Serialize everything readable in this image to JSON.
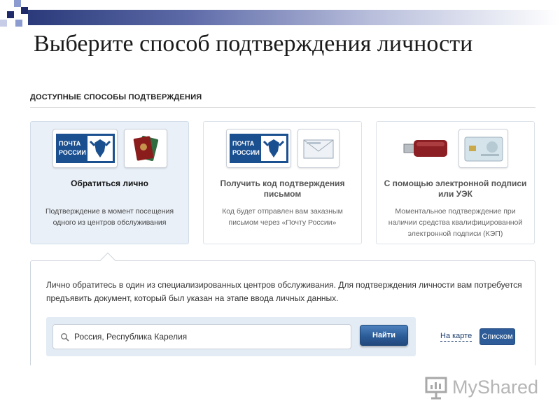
{
  "slide": {
    "title": "Выберите способ подтверждения личности",
    "accent_colors": [
      "#1f2a6b",
      "#8c9bd0",
      "#2a3a7a"
    ]
  },
  "section": {
    "title": "ДОСТУПНЫЕ СПОСОБЫ ПОДТВЕРЖДЕНИЯ"
  },
  "cards": [
    {
      "title": "Обратиться лично",
      "description": "Подтверждение в момент посещения одного из центров обслуживания",
      "state": "active",
      "icons": [
        "pochta-rossii-logo",
        "passport-icon"
      ],
      "logo_text": "ПОЧТА РОССИИ"
    },
    {
      "title": "Получить код подтверждения письмом",
      "description": "Код будет отправлен вам заказным письмом через «Почту России»",
      "state": "inactive",
      "icons": [
        "pochta-rossii-logo",
        "envelope-icon"
      ],
      "logo_text": "ПОЧТА РОССИИ"
    },
    {
      "title": "С помощью электронной подписи или УЭК",
      "description": "Моментальное подтверждение при наличии средства квалифицированной электронной подписи (КЭП)",
      "state": "inactive",
      "icons": [
        "usb-token-icon",
        "uek-card-icon"
      ]
    }
  ],
  "detail": {
    "text": "Лично обратитесь в один из специализированных центров обслуживания. Для подтверждения личности вам потребуется предъявить документ, который был указан на этапе ввода личных данных.",
    "search_value": "Россия, Республика Карелия",
    "search_icon": "search-icon",
    "find_label": "Найти",
    "map_link_label": "На карте",
    "list_button_label": "Списком",
    "button_color": "#2d5c98"
  },
  "watermark": {
    "text": "MyShared",
    "icon": "presentation-icon"
  }
}
